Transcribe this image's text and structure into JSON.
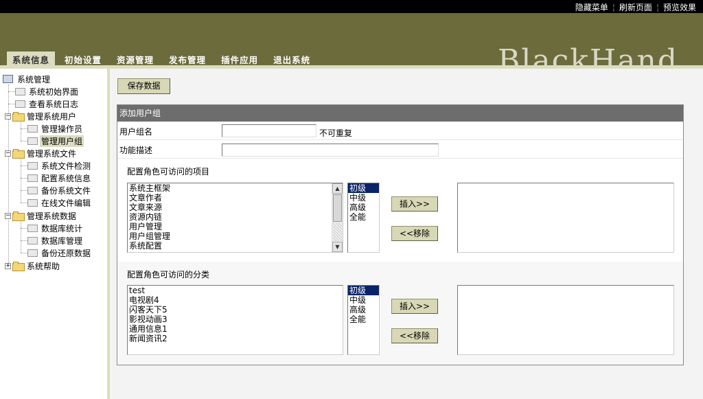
{
  "top_links": [
    "隐藏菜单",
    "刷新页面",
    "预览效果"
  ],
  "brand": "BlackHand",
  "nav_tabs": [
    {
      "label": "系统信息",
      "active": true
    },
    {
      "label": "初始设置",
      "active": false
    },
    {
      "label": "资源管理",
      "active": false
    },
    {
      "label": "发布管理",
      "active": false
    },
    {
      "label": "插件应用",
      "active": false
    },
    {
      "label": "退出系统",
      "active": false
    }
  ],
  "tree": {
    "root": "系统管理",
    "items": [
      {
        "label": "系统初始界面"
      },
      {
        "label": "查看系统日志"
      },
      {
        "label": "管理系统用户",
        "children": [
          "管理操作员",
          "管理用户组"
        ]
      },
      {
        "label": "管理系统文件",
        "children": [
          "系统文件检测",
          "配置系统信息",
          "备份系统文件",
          "在线文件编辑"
        ]
      },
      {
        "label": "管理系统数据",
        "children": [
          "数据库统计",
          "数据库管理",
          "备份还原数据"
        ]
      },
      {
        "label": "系统帮助"
      }
    ],
    "selected": "管理用户组"
  },
  "main": {
    "save_button": "保存数据",
    "panel_title": "添加用户组",
    "group_name_label": "用户组名",
    "group_name_value": "",
    "group_name_note": "不可重复",
    "description_label": "功能描述",
    "description_value": "",
    "section1": {
      "title": "配置角色可访问的项目",
      "items": [
        "系统主框架",
        "文章作者",
        "文章来源",
        "资源内链",
        "用户管理",
        "用户组管理",
        "系统配置"
      ],
      "levels": [
        "初级",
        "中级",
        "高级",
        "全能"
      ],
      "selected_level": "初级",
      "insert_label": "插入>>",
      "remove_label": "<<移除",
      "selected_items": []
    },
    "section2": {
      "title": "配置角色可访问的分类",
      "items": [
        "test",
        "电视剧4",
        "闪客天下5",
        "影视动画3",
        "通用信息1",
        "新闻资讯2"
      ],
      "levels": [
        "初级",
        "中级",
        "高级",
        "全能"
      ],
      "selected_level": "初级",
      "insert_label": "插入>>",
      "remove_label": "<<移除",
      "selected_items": []
    }
  },
  "colors": {
    "header": "#6b6b3c",
    "accent_light": "#dcdcc0",
    "panel_head": "#6d6d6d",
    "selection": "#0a246a"
  }
}
